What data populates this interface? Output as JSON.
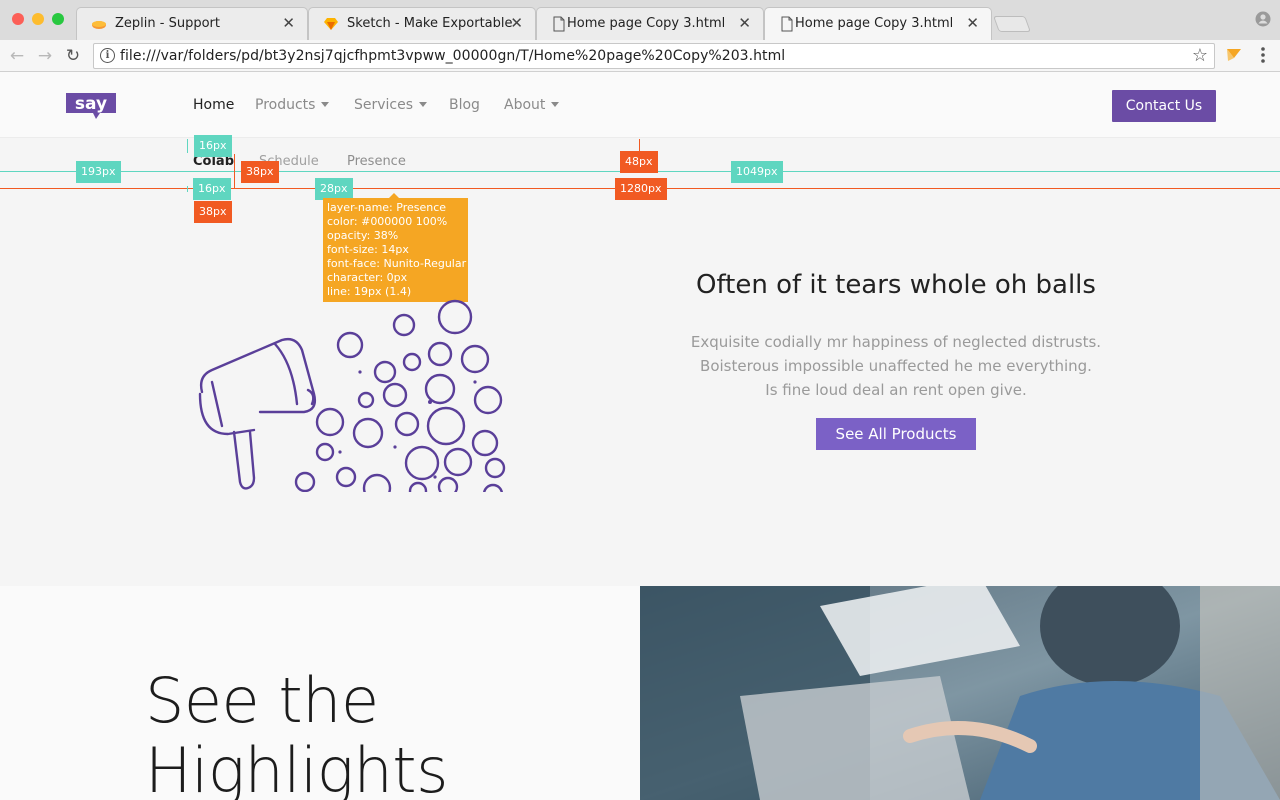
{
  "browser": {
    "tabs": [
      {
        "label": "Zeplin - Support",
        "icon": "zeplin-icon"
      },
      {
        "label": "Sketch - Make Exportable",
        "icon": "sketch-icon"
      },
      {
        "label": "Home page Copy 3.html",
        "icon": "document-icon"
      },
      {
        "label": "Home page Copy 3.html",
        "icon": "document-icon",
        "active": true
      }
    ],
    "url": "file:///var/folders/pd/bt3y2nsj7qjcfhpmt3vpww_00000gn/T/Home%20page%20Copy%203.html"
  },
  "site": {
    "logo_text": "say",
    "brand_color": "#6b4ca5",
    "menu": [
      {
        "label": "Home",
        "current": true
      },
      {
        "label": "Products",
        "dropdown": true
      },
      {
        "label": "Services",
        "dropdown": true
      },
      {
        "label": "Blog"
      },
      {
        "label": "About",
        "dropdown": true
      }
    ],
    "contact_label": "Contact Us",
    "subnav": [
      "Colab",
      "Schedule",
      "Presence"
    ]
  },
  "measurements": {
    "badges": [
      "16px",
      "16px",
      "38px",
      "38px",
      "28px",
      "193px",
      "48px",
      "1280px",
      "1049px"
    ],
    "tooltip": [
      "layer-name: Presence",
      "color: #000000 100%",
      "opacity: 38%",
      "font-size: 14px",
      "font-face: Nunito-Regular",
      "character: 0px",
      "line: 19px (1.4)"
    ]
  },
  "hero": {
    "title": "Often of it tears whole oh balls",
    "lines": [
      "Exquisite codially mr happiness of neglected distrusts.",
      "Boisterous impossible unaffected he me everything.",
      "Is fine loud deal an rent open give."
    ],
    "button_label": "See All Products"
  },
  "highlights": {
    "title_line1": "See the",
    "title_line2": "Highlights"
  }
}
